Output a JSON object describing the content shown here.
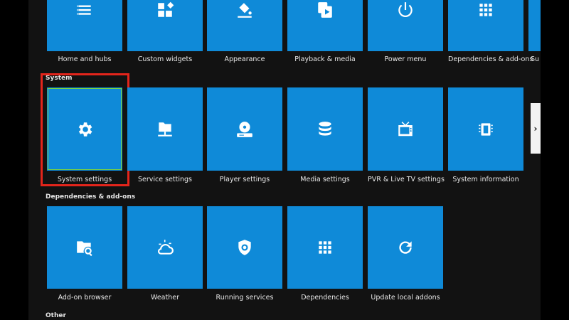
{
  "colors": {
    "tile": "#0f8ad8",
    "focus_border": "#e3251b",
    "focus_inner": "#7cd43d",
    "background": "#121212"
  },
  "row1": {
    "tiles": [
      {
        "label": "Home and hubs",
        "icon": "list-icon"
      },
      {
        "label": "Custom widgets",
        "icon": "widgets-icon"
      },
      {
        "label": "Appearance",
        "icon": "paint-bucket-icon"
      },
      {
        "label": "Playback & media",
        "icon": "playlist-play-icon"
      },
      {
        "label": "Power menu",
        "icon": "power-icon"
      },
      {
        "label": "Dependencies & add-ons",
        "icon": "grid-icon"
      },
      {
        "label": "Su",
        "icon": ""
      }
    ]
  },
  "system": {
    "title": "System",
    "tiles": [
      {
        "label": "System settings",
        "icon": "gear-icon"
      },
      {
        "label": "Service settings",
        "icon": "network-folder-icon"
      },
      {
        "label": "Player settings",
        "icon": "disc-player-icon"
      },
      {
        "label": "Media settings",
        "icon": "database-icon"
      },
      {
        "label": "PVR & Live TV settings",
        "icon": "tv-icon"
      },
      {
        "label": "System information",
        "icon": "chip-icon"
      }
    ],
    "next_arrow": "›"
  },
  "dependencies": {
    "title": "Dependencies & add-ons",
    "tiles": [
      {
        "label": "Add-on browser",
        "icon": "folder-search-icon"
      },
      {
        "label": "Weather",
        "icon": "weather-icon"
      },
      {
        "label": "Running services",
        "icon": "shield-icon"
      },
      {
        "label": "Dependencies",
        "icon": "grid-icon"
      },
      {
        "label": "Update local addons",
        "icon": "refresh-icon"
      }
    ]
  },
  "other": {
    "title": "Other"
  }
}
